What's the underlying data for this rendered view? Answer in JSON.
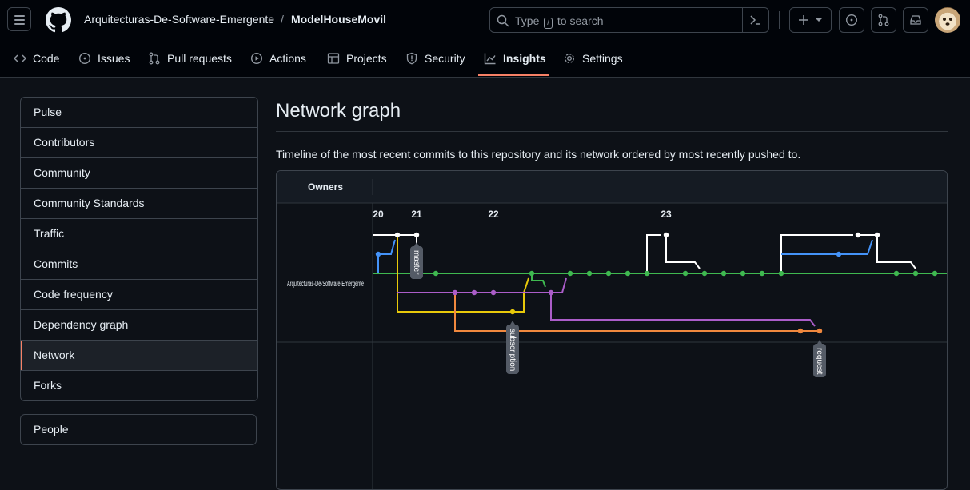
{
  "header": {
    "owner": "Arquitecturas-De-Software-Emergente",
    "separator": "/",
    "repo": "ModelHouseMovil",
    "search_placeholder_before": "Type",
    "search_key": "/",
    "search_placeholder_after": "to search"
  },
  "tabs": [
    {
      "label": "Code",
      "icon": "code-icon"
    },
    {
      "label": "Issues",
      "icon": "issue-icon"
    },
    {
      "label": "Pull requests",
      "icon": "pull-request-icon"
    },
    {
      "label": "Actions",
      "icon": "play-icon"
    },
    {
      "label": "Projects",
      "icon": "table-icon"
    },
    {
      "label": "Security",
      "icon": "shield-icon"
    },
    {
      "label": "Insights",
      "icon": "graph-icon",
      "active": true
    },
    {
      "label": "Settings",
      "icon": "gear-icon"
    }
  ],
  "sidebar": {
    "items": [
      "Pulse",
      "Contributors",
      "Community",
      "Community Standards",
      "Traffic",
      "Commits",
      "Code frequency",
      "Dependency graph",
      "Network",
      "Forks"
    ],
    "selected": "Network",
    "people": "People"
  },
  "page": {
    "title": "Network graph",
    "description": "Timeline of the most recent commits to this repository and its network ordered by most recently pushed to."
  },
  "graph": {
    "owners_header": "Owners",
    "owner": "Arquitecturas-De-Software-Emergente",
    "dates": [
      "20",
      "21",
      "22",
      "23"
    ],
    "branch_labels": [
      "master",
      "subscription",
      "request"
    ],
    "colors": {
      "master": "#3fb950",
      "white": "#ffffff",
      "blue": "#4493f8",
      "purple": "#ab5dc9",
      "yellow": "#e8c90a",
      "orange": "#f0883e",
      "label_bg": "#545b66",
      "accent": "#f78166"
    }
  }
}
